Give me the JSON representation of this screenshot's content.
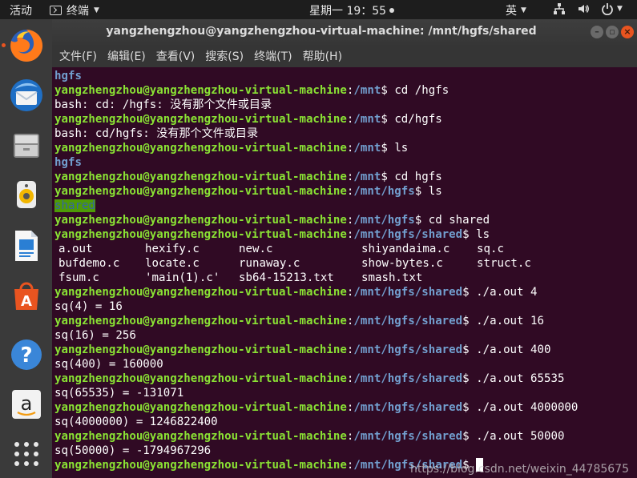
{
  "topbar": {
    "activities": "活动",
    "app_name": "终端",
    "clock": "星期一 19：55",
    "ime": "英"
  },
  "window": {
    "title": "yangzhengzhou@yangzhengzhou-virtual-machine: /mnt/hgfs/shared"
  },
  "menubar": {
    "items": [
      "文件(F)",
      "编辑(E)",
      "查看(V)",
      "搜索(S)",
      "终端(T)",
      "帮助(H)"
    ]
  },
  "dock": {
    "items": [
      "firefox-icon",
      "thunderbird-icon",
      "files-icon",
      "rhythmbox-icon",
      "libreoffice-writer-icon",
      "software-center-icon",
      "help-icon",
      "amazon-icon",
      "show-apps-icon"
    ]
  },
  "terminal": {
    "user": "yangzhengzhou@yangzhengzhou-virtual-machine",
    "lines": [
      {
        "type": "out",
        "text": "hgfs",
        "style": "dir"
      },
      {
        "type": "prompt",
        "path": "/mnt",
        "cmd": "cd /hgfs"
      },
      {
        "type": "out",
        "text": "bash: cd: /hgfs: 没有那个文件或目录"
      },
      {
        "type": "prompt",
        "path": "/mnt",
        "cmd": "cd/hgfs"
      },
      {
        "type": "out",
        "text": "bash: cd/hgfs: 没有那个文件或目录"
      },
      {
        "type": "prompt",
        "path": "/mnt",
        "cmd": "ls"
      },
      {
        "type": "out",
        "text": "hgfs",
        "style": "dir"
      },
      {
        "type": "prompt",
        "path": "/mnt",
        "cmd": "cd hgfs"
      },
      {
        "type": "prompt",
        "path": "/mnt/hgfs",
        "cmd": "ls"
      },
      {
        "type": "out",
        "text": "shared",
        "style": "hl"
      },
      {
        "type": "prompt",
        "path": "/mnt/hgfs",
        "cmd": "cd shared"
      },
      {
        "type": "prompt",
        "path": "/mnt/hgfs/shared",
        "cmd": "ls"
      },
      {
        "type": "cols",
        "cells": [
          "a.out",
          "hexify.c",
          "new.c",
          "shiyandaima.c",
          "sq.c"
        ]
      },
      {
        "type": "cols",
        "cells": [
          "bufdemo.c",
          "locate.c",
          "runaway.c",
          "show-bytes.c",
          "struct.c"
        ]
      },
      {
        "type": "cols",
        "cells": [
          "fsum.c",
          "'main(1).c'",
          "sb64-15213.txt",
          "smash.txt",
          ""
        ]
      },
      {
        "type": "prompt",
        "path": "/mnt/hgfs/shared",
        "cmd": "./a.out 4"
      },
      {
        "type": "out",
        "text": "sq(4) = 16"
      },
      {
        "type": "prompt",
        "path": "/mnt/hgfs/shared",
        "cmd": "./a.out 16"
      },
      {
        "type": "out",
        "text": "sq(16) = 256"
      },
      {
        "type": "prompt",
        "path": "/mnt/hgfs/shared",
        "cmd": "./a.out 400"
      },
      {
        "type": "out",
        "text": "sq(400) = 160000"
      },
      {
        "type": "prompt",
        "path": "/mnt/hgfs/shared",
        "cmd": "./a.out 65535"
      },
      {
        "type": "out",
        "text": "sq(65535) = -131071"
      },
      {
        "type": "prompt",
        "path": "/mnt/hgfs/shared",
        "cmd": "./a.out 4000000"
      },
      {
        "type": "out",
        "text": "sq(4000000) = 1246822400"
      },
      {
        "type": "prompt",
        "path": "/mnt/hgfs/shared",
        "cmd": "./a.out 50000"
      },
      {
        "type": "out",
        "text": "sq(50000) = -1794967296"
      },
      {
        "type": "prompt",
        "path": "/mnt/hgfs/shared",
        "cmd": "",
        "cursor": true
      }
    ]
  },
  "watermark": "https://blog.csdn.net/weixin_44785675",
  "colors": {
    "terminal_bg": "#300a24",
    "user_green": "#8ae234",
    "path_blue": "#729fcf",
    "accent_orange": "#e95420"
  }
}
